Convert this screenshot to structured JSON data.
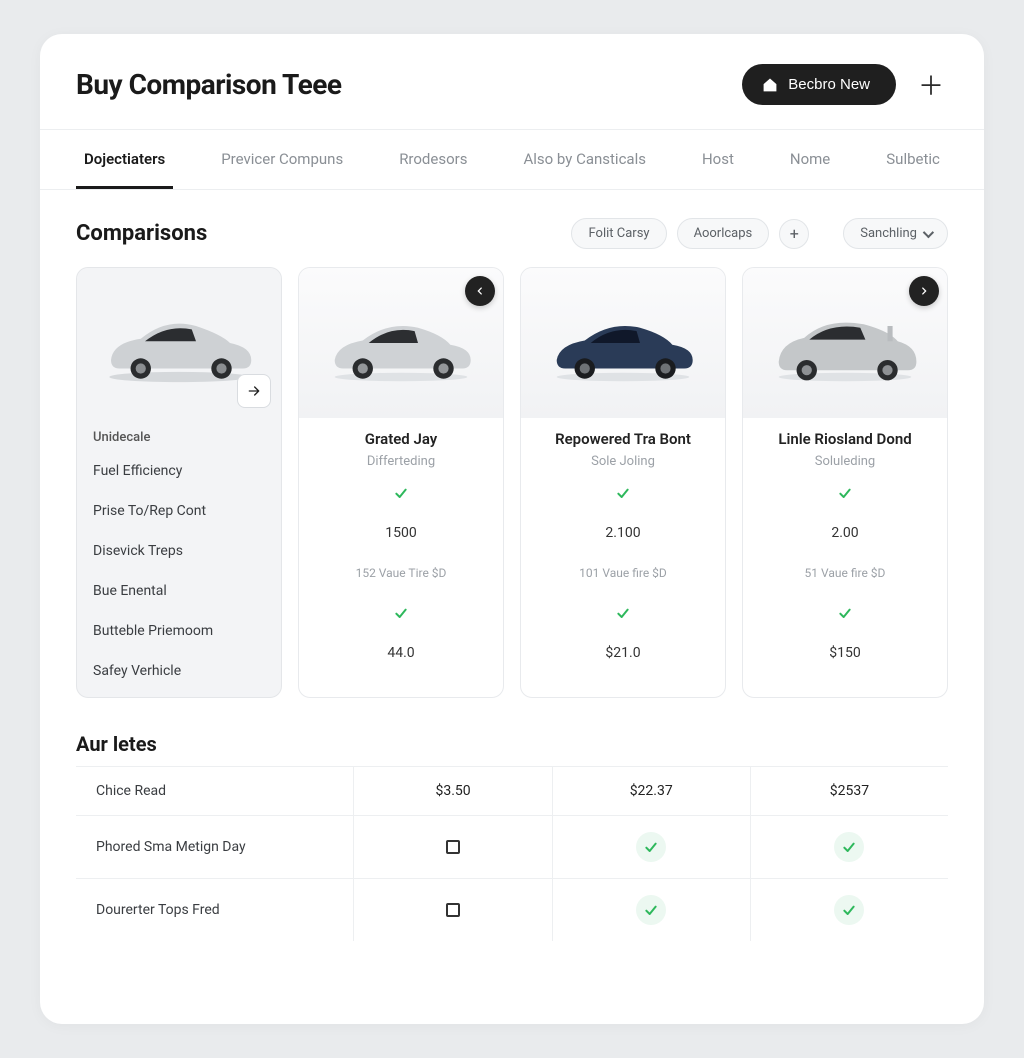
{
  "header": {
    "title": "Buy Comparison Teee",
    "primary_btn": "Becbro New"
  },
  "tabs": [
    "Dojectiaters",
    "Previcer Compuns",
    "Rrodesors",
    "Also by Cansticals",
    "Host",
    "Nome",
    "Sulbetic"
  ],
  "active_tab": 0,
  "comparisons": {
    "title": "Comparisons",
    "filters": [
      "Folit Carsy",
      "Aoorlcaps"
    ],
    "sort_label": "Sanchling",
    "feature_labels": [
      "Unidecale",
      "Fuel Efficiency",
      "Prise To/Rep Cont",
      "Disevick Treps",
      "Bue Enental",
      "Butteble Priemoom",
      "Safey Verhicle"
    ],
    "cars": [
      {
        "name": "Grated Jay",
        "sub": "Differteding",
        "row3": "1500",
        "row4": "152 Vaue Tire $D",
        "row6": "44.0",
        "body": "#c9ccce",
        "shade": "#9fa3a6"
      },
      {
        "name": "Repowered Tra Bont",
        "sub": "Sole Joling",
        "row3": "2.100",
        "row4": "101 Vaue fire $D",
        "row6": "$21.0",
        "body": "#2a3b57",
        "shade": "#1c2a40"
      },
      {
        "name": "Linle Riosland Dond",
        "sub": "Soluleding",
        "row3": "2.00",
        "row4": "51 Vaue fire $D",
        "row6": "$150",
        "body": "#c2c5c7",
        "shade": "#9a9ea1"
      }
    ]
  },
  "aurletes": {
    "title": "Aur letes",
    "rows": [
      {
        "label": "Chice Read",
        "vals": [
          "$3.50",
          "$22.37",
          "$2537"
        ]
      },
      {
        "label": "Phored Sma Metign Day",
        "vals": [
          "square",
          "check",
          "check"
        ]
      },
      {
        "label": "Dourerter Tops Fred",
        "vals": [
          "square",
          "check",
          "check"
        ]
      }
    ]
  }
}
